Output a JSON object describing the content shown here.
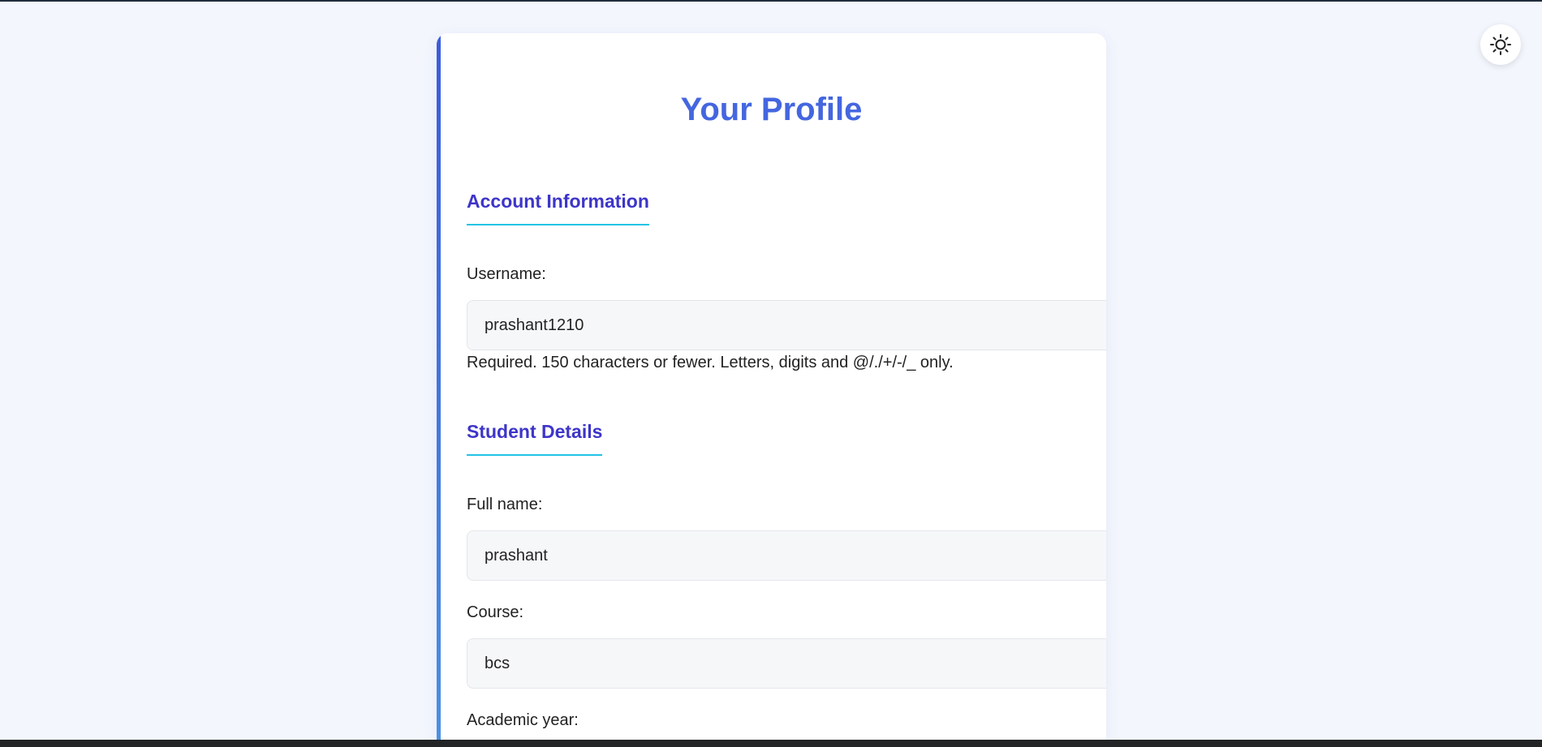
{
  "theme_toggle": {
    "icon": "sun-icon"
  },
  "page": {
    "title": "Your Profile"
  },
  "account_section": {
    "title": "Account Information",
    "username_label": "Username:",
    "username_value": "prashant1210",
    "username_help": "Required. 150 characters or fewer. Letters, digits and @/./+/-/_ only."
  },
  "student_section": {
    "title": "Student Details",
    "fullname_label": "Full name:",
    "fullname_value": "prashant",
    "course_label": "Course:",
    "course_value": "bcs",
    "academic_year_label": "Academic year:"
  },
  "colors": {
    "accent": "#4466e0",
    "section_title": "#3d35c9",
    "underline": "#22c3e6",
    "background": "#f3f6fd"
  }
}
